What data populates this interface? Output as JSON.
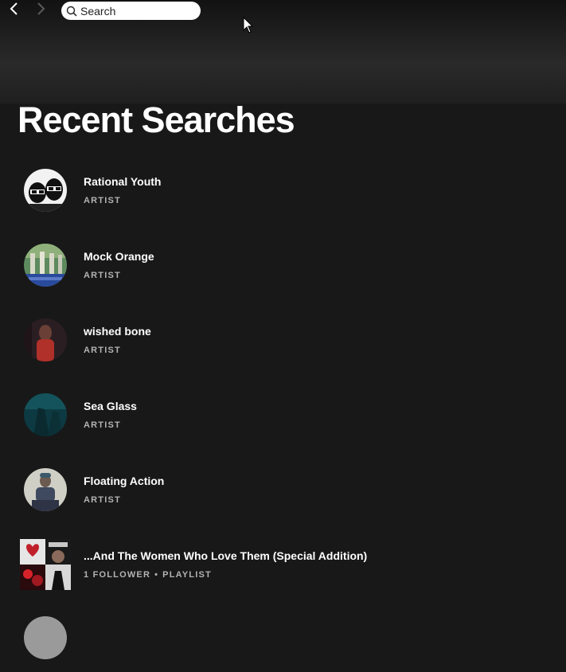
{
  "nav": {
    "back_icon": "chevron-left-icon",
    "forward_icon": "chevron-right-icon"
  },
  "search": {
    "placeholder": "Search",
    "icon": "search-icon"
  },
  "page": {
    "title": "Recent Searches"
  },
  "results": [
    {
      "name": "Rational Youth",
      "type": "ARTIST"
    },
    {
      "name": "Mock Orange",
      "type": "ARTIST"
    },
    {
      "name": "wished bone",
      "type": "ARTIST"
    },
    {
      "name": "Sea Glass",
      "type": "ARTIST"
    },
    {
      "name": "Floating Action",
      "type": "ARTIST"
    },
    {
      "name": "...And The Women Who Love Them (Special Addition)",
      "followers": "1 FOLLOWER",
      "separator": "•",
      "type": "PLAYLIST"
    }
  ],
  "colors": {
    "background": "#181818",
    "text_primary": "#ffffff",
    "text_secondary": "#b3b3b3"
  }
}
